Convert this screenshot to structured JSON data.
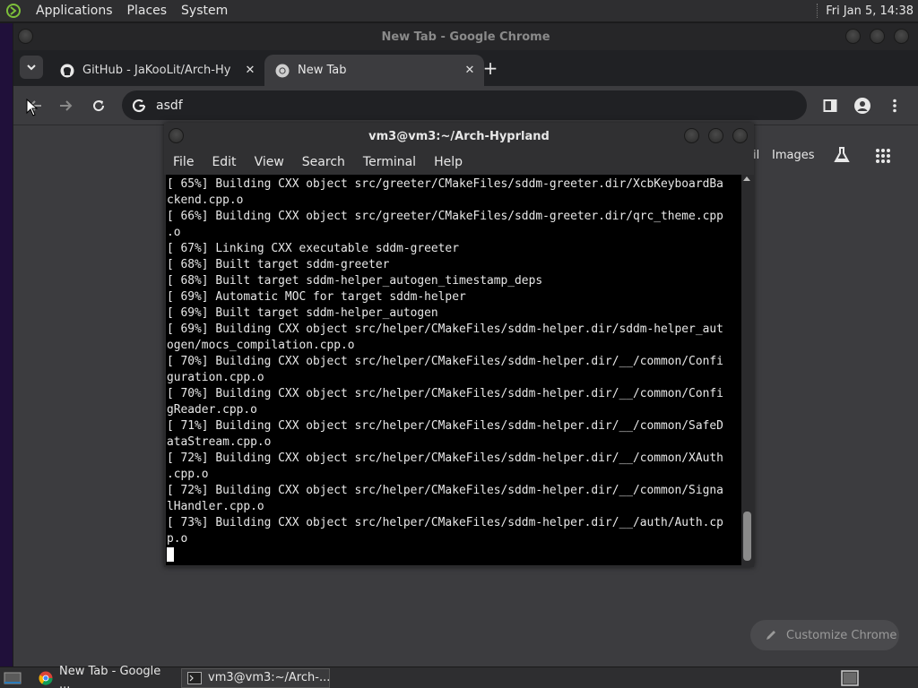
{
  "top_panel": {
    "menus": [
      "Applications",
      "Places",
      "System"
    ],
    "clock": "Fri Jan  5, 14:38"
  },
  "chrome": {
    "window_title": "New Tab - Google Chrome",
    "tabs": [
      {
        "title": "GitHub - JaKooLit/Arch-Hypr",
        "icon": "github-icon"
      },
      {
        "title": "New Tab",
        "icon": "chrome-icon"
      }
    ],
    "omnibox_text": "asdf",
    "links": {
      "gmail_partial": "il",
      "images": "Images"
    },
    "customize_label": "Customize Chrome"
  },
  "terminal": {
    "title": "vm3@vm3:~/Arch-Hyprland",
    "menus": [
      "File",
      "Edit",
      "View",
      "Search",
      "Terminal",
      "Help"
    ],
    "lines": [
      "[ 65%] Building CXX object src/greeter/CMakeFiles/sddm-greeter.dir/XcbKeyboardBa",
      "ckend.cpp.o",
      "[ 66%] Building CXX object src/greeter/CMakeFiles/sddm-greeter.dir/qrc_theme.cpp",
      ".o",
      "[ 67%] Linking CXX executable sddm-greeter",
      "[ 68%] Built target sddm-greeter",
      "[ 68%] Built target sddm-helper_autogen_timestamp_deps",
      "[ 69%] Automatic MOC for target sddm-helper",
      "[ 69%] Built target sddm-helper_autogen",
      "[ 69%] Building CXX object src/helper/CMakeFiles/sddm-helper.dir/sddm-helper_aut",
      "ogen/mocs_compilation.cpp.o",
      "[ 70%] Building CXX object src/helper/CMakeFiles/sddm-helper.dir/__/common/Confi",
      "guration.cpp.o",
      "[ 70%] Building CXX object src/helper/CMakeFiles/sddm-helper.dir/__/common/Confi",
      "gReader.cpp.o",
      "[ 71%] Building CXX object src/helper/CMakeFiles/sddm-helper.dir/__/common/SafeD",
      "ataStream.cpp.o",
      "[ 72%] Building CXX object src/helper/CMakeFiles/sddm-helper.dir/__/common/XAuth",
      ".cpp.o",
      "[ 72%] Building CXX object src/helper/CMakeFiles/sddm-helper.dir/__/common/Signa",
      "lHandler.cpp.o",
      "[ 73%] Building CXX object src/helper/CMakeFiles/sddm-helper.dir/__/auth/Auth.cp",
      "p.o"
    ]
  },
  "taskbar": {
    "items": [
      {
        "label": "New Tab - Google ...",
        "icon": "chrome-icon"
      },
      {
        "label": "vm3@vm3:~/Arch-...",
        "icon": "terminal-icon"
      }
    ]
  }
}
